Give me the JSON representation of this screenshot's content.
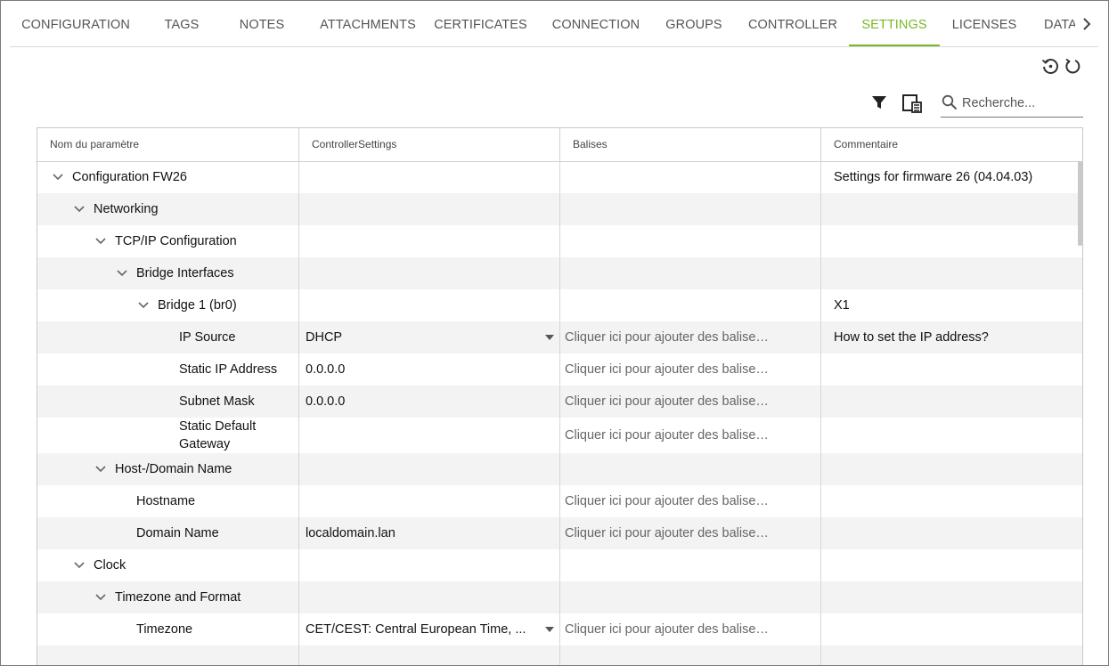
{
  "tabs": [
    {
      "label": "CONFIGURATION",
      "active": false
    },
    {
      "label": "TAGS",
      "active": false
    },
    {
      "label": "NOTES",
      "active": false
    },
    {
      "label": "ATTACHMENTS",
      "active": false
    },
    {
      "label": "CERTIFICATES",
      "active": false
    },
    {
      "label": "CONNECTION",
      "active": false
    },
    {
      "label": "GROUPS",
      "active": false
    },
    {
      "label": "CONTROLLER",
      "active": false
    },
    {
      "label": "SETTINGS",
      "active": true
    },
    {
      "label": "LICENSES",
      "active": false
    },
    {
      "label": "DATA",
      "active": false
    }
  ],
  "toolbar": {
    "history_icon": "history-icon",
    "reset_icon": "refresh-icon",
    "filter_icon": "filter-icon",
    "columns_icon": "column-chooser-icon",
    "search_placeholder": "Recherche..."
  },
  "colors": {
    "accent": "#7ab829"
  },
  "grid": {
    "headers": [
      "Nom du paramètre",
      "ControllerSettings",
      "Balises",
      "Commentaire"
    ],
    "tag_placeholder": "Cliquer ici pour ajouter des balises...",
    "rows": [
      {
        "name": "Configuration FW26",
        "value": "",
        "tags": false,
        "comment": "Settings for firmware 26 (04.04.03)",
        "expandable": true,
        "dropdown": false
      },
      {
        "name": "Networking",
        "value": "",
        "tags": false,
        "comment": "",
        "expandable": true,
        "dropdown": false
      },
      {
        "name": "TCP/IP Configuration",
        "value": "",
        "tags": false,
        "comment": "",
        "expandable": true,
        "dropdown": false
      },
      {
        "name": "Bridge Interfaces",
        "value": "",
        "tags": false,
        "comment": "",
        "expandable": true,
        "dropdown": false
      },
      {
        "name": "Bridge 1 (br0)",
        "value": "",
        "tags": false,
        "comment": "X1",
        "expandable": true,
        "dropdown": false
      },
      {
        "name": "IP Source",
        "value": "DHCP",
        "tags": true,
        "comment": "How to set the IP address?",
        "expandable": false,
        "dropdown": true
      },
      {
        "name": "Static IP Address",
        "value": "0.0.0.0",
        "tags": true,
        "comment": "",
        "expandable": false,
        "dropdown": false
      },
      {
        "name": "Subnet Mask",
        "value": "0.0.0.0",
        "tags": true,
        "comment": "",
        "expandable": false,
        "dropdown": false
      },
      {
        "name": "Static Default Gateway",
        "value": "",
        "tags": true,
        "comment": "",
        "expandable": false,
        "dropdown": false
      },
      {
        "name": "Host-/Domain Name",
        "value": "",
        "tags": false,
        "comment": "",
        "expandable": true,
        "dropdown": false
      },
      {
        "name": "Hostname",
        "value": "",
        "tags": true,
        "comment": "",
        "expandable": false,
        "dropdown": false
      },
      {
        "name": "Domain Name",
        "value": "localdomain.lan",
        "tags": true,
        "comment": "",
        "expandable": false,
        "dropdown": false
      },
      {
        "name": "Clock",
        "value": "",
        "tags": false,
        "comment": "",
        "expandable": true,
        "dropdown": false
      },
      {
        "name": "Timezone and Format",
        "value": "",
        "tags": false,
        "comment": "",
        "expandable": true,
        "dropdown": false
      },
      {
        "name": "Timezone",
        "value": "CET/CEST: Central European Time, ...",
        "tags": true,
        "comment": "",
        "expandable": false,
        "dropdown": true
      }
    ]
  }
}
